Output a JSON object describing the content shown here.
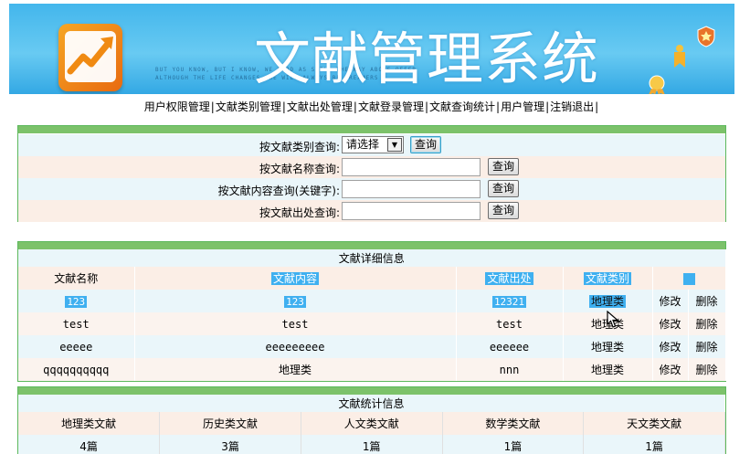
{
  "banner": {
    "title": "文献管理系统",
    "tagline_1": "BUT YOU KNOW, BUT I KNOW, WE GOOD AS STILL THE WAY ABOVE OFFER",
    "tagline_2": "ALTHOUGH THE LIFE CHANGES, WE WILL ALWAYS BE DREAMERS"
  },
  "nav": {
    "items": [
      "用户权限管理",
      "文献类别管理",
      "文献出处管理",
      "文献登录管理",
      "文献查询统计",
      "用户管理",
      "注销退出"
    ],
    "separator": "|"
  },
  "search": {
    "rows": [
      {
        "label": "按文献类别查询:",
        "select_value": "请选择",
        "button": "查询"
      },
      {
        "label": "按文献名称查询:",
        "input_value": "",
        "button": "查询"
      },
      {
        "label": "按文献内容查询(关键字):",
        "input_value": "",
        "button": "查询"
      },
      {
        "label": "按文献出处查询:",
        "input_value": "",
        "button": "查询"
      }
    ]
  },
  "detail": {
    "caption": "文献详细信息",
    "headers": [
      "文献名称",
      "文献内容",
      "文献出处",
      "文献类别"
    ],
    "edit_label": "修改",
    "delete_label": "删除",
    "rows": [
      {
        "name": "123",
        "content": "123",
        "source": "12321",
        "category": "地理类"
      },
      {
        "name": "test",
        "content": "test",
        "source": "test",
        "category": "地理类"
      },
      {
        "name": "eeeee",
        "content": "eeeeeeeee",
        "source": "eeeeee",
        "category": "地理类"
      },
      {
        "name": "qqqqqqqqqq",
        "content": "地理类",
        "source": "nnn",
        "category": "地理类"
      }
    ]
  },
  "stats": {
    "caption": "文献统计信息",
    "headers": [
      "地理类文献",
      "历史类文献",
      "人文类文献",
      "数学类文献",
      "天文类文献"
    ],
    "values": [
      "4篇",
      "3篇",
      "1篇",
      "1篇",
      "1篇"
    ]
  },
  "colors": {
    "panel_border": "#5cb85c",
    "selection_highlight": "#3fb0f0",
    "row_blue": "#eaf6fa",
    "row_peach": "#fbeee6"
  }
}
